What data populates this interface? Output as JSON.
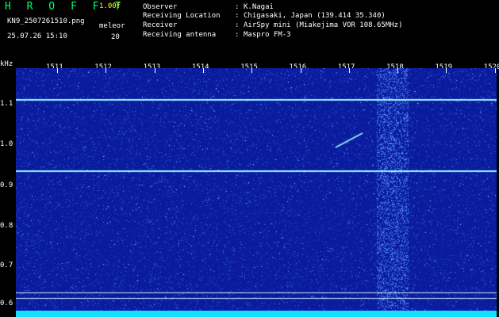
{
  "header": {
    "app_title": "H R O F F T",
    "version": "1.00f",
    "file_name": "KN9_2507261510.png",
    "timestamp": "25.07.26 15:10",
    "mode_label": "meleor",
    "count": "20"
  },
  "info": {
    "observer_label": "Observer",
    "observer_value": "K.Nagai",
    "location_label": "Receiving Location",
    "location_value": "Chigasaki, Japan (139.414 35.340)",
    "receiver_label": "Receiver",
    "receiver_value": "AirSpy mini (Miakejima VOR 108.65MHz)",
    "antenna_label": "Receiving antenna",
    "antenna_value": "Maspro FM-3",
    "separator": ":"
  },
  "spectrogram": {
    "y_unit": "kHz",
    "y_ticks": [
      "1.1",
      "1.0",
      "0.9",
      "0.8",
      "0.7",
      "0.6"
    ],
    "x_ticks": [
      "1511",
      "1512",
      "1513",
      "1514",
      "1515",
      "1516",
      "1517",
      "1518",
      "1519",
      "1520"
    ],
    "colors": {
      "background": "#0a1c9c",
      "noise": "#3a6cff",
      "line": "#9ff8ff",
      "bar": "#16e0ff"
    }
  }
}
